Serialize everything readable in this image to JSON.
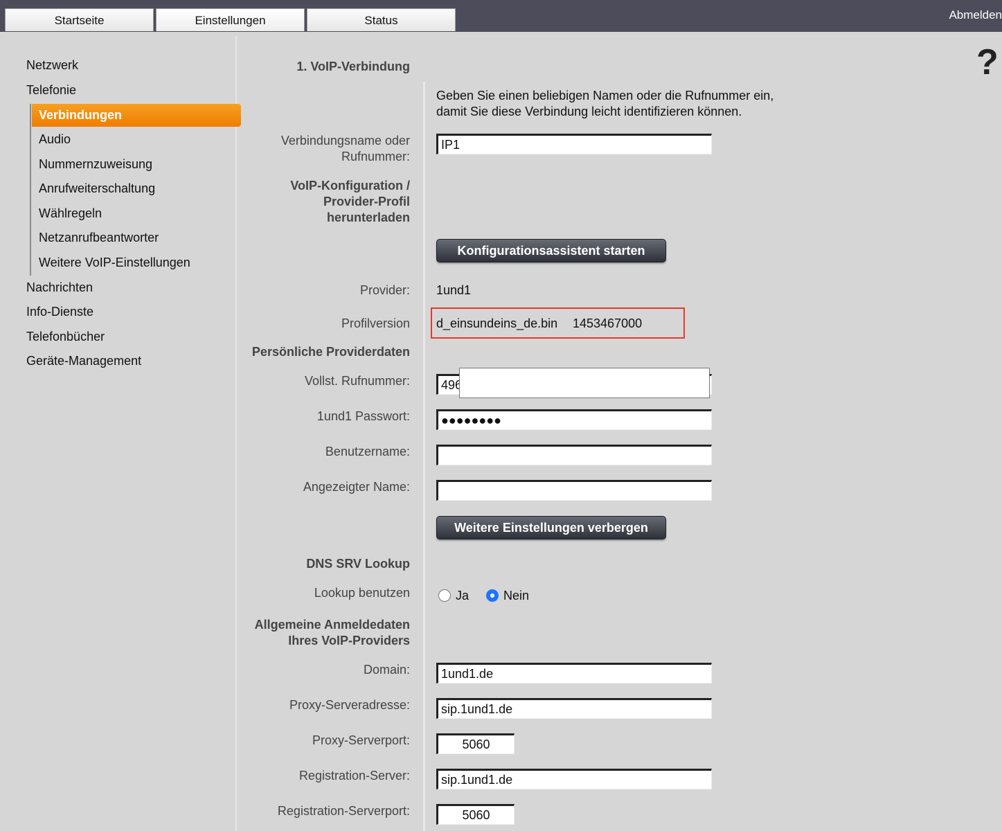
{
  "tabs": [
    {
      "label": "Startseite"
    },
    {
      "label": "Einstellungen"
    },
    {
      "label": "Status"
    }
  ],
  "logout_label": "Abmelden",
  "help_label": "?",
  "sidebar": {
    "items": [
      {
        "label": "Netzwerk"
      },
      {
        "label": "Telefonie"
      },
      {
        "label": "Verbindungen"
      },
      {
        "label": "Audio"
      },
      {
        "label": "Nummernzuweisung"
      },
      {
        "label": "Anrufweiterschaltung"
      },
      {
        "label": "Wählregeln"
      },
      {
        "label": "Netzanrufbeantworter"
      },
      {
        "label": "Weitere VoIP-Einstellungen"
      },
      {
        "label": "Nachrichten"
      },
      {
        "label": "Info-Dienste"
      },
      {
        "label": "Telefonbücher"
      },
      {
        "label": "Geräte-Management"
      }
    ]
  },
  "form": {
    "section_title": "1. VoIP-Verbindung",
    "intro_line1": "Geben Sie einen beliebigen Namen oder die Rufnummer ein,",
    "intro_line2": "damit Sie diese Verbindung leicht identifizieren können.",
    "conn_name_label1": "Verbindungsname oder",
    "conn_name_label2": "Rufnummer:",
    "conn_name_value": "IP1",
    "voip_cfg_line1": "VoIP-Konfiguration /",
    "voip_cfg_line2": "Provider-Profil",
    "voip_cfg_line3": "herunterladen",
    "wizard_button": "Konfigurationsassistent starten",
    "provider_label": "Provider:",
    "provider_value": "1und1",
    "profile_label": "Profilversion",
    "profile_file": "d_einsundeins_de.bin",
    "profile_version": "1453467000",
    "personal_heading": "Persönliche Providerdaten",
    "phone_label": "Vollst. Rufnummer:",
    "phone_value": "496",
    "password_label": "1und1 Passwort:",
    "password_value": "●●●●●●●●",
    "username_label": "Benutzername:",
    "username_value": "",
    "display_name_label": "Angezeigter Name:",
    "display_name_value": "",
    "hide_button": "Weitere Einstellungen verbergen",
    "dns_heading": "DNS SRV Lookup",
    "lookup_label": "Lookup benutzen",
    "radio_yes": "Ja",
    "radio_no": "Nein",
    "general_line1": "Allgemeine Anmeldedaten",
    "general_line2": "Ihres VoIP-Providers",
    "domain_label": "Domain:",
    "domain_value": "1und1.de",
    "proxy_label": "Proxy-Serveradresse:",
    "proxy_value": "sip.1und1.de",
    "proxy_port_label": "Proxy-Serverport:",
    "proxy_port_value": "5060",
    "reg_label": "Registration-Server:",
    "reg_value": "sip.1und1.de",
    "reg_port_label": "Registration-Serverport:",
    "reg_port_value": "5060"
  },
  "colors": {
    "accent": "#f07c00",
    "topbar": "#4d4c5a",
    "highlight_border": "#e33a2e",
    "radio_selected": "#1e73ff"
  }
}
